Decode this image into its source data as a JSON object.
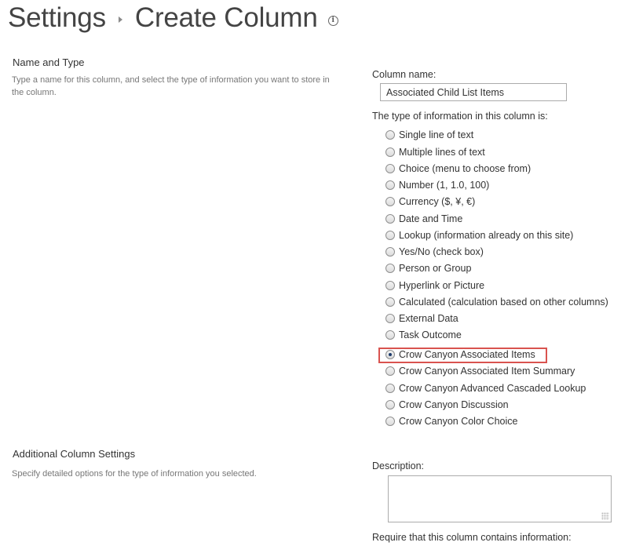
{
  "header": {
    "breadcrumb_root": "Settings",
    "page_title": "Create Column",
    "info_icon_glyph": "i"
  },
  "sections": {
    "name_and_type": {
      "title": "Name and Type",
      "description": "Type a name for this column, and select the type of information you want to store in the column."
    },
    "additional": {
      "title": "Additional Column Settings",
      "description": "Specify detailed options for the type of information you selected."
    }
  },
  "form": {
    "column_name_label": "Column name:",
    "column_name_value": "Associated Child List Items",
    "type_label": "The type of information in this column is:",
    "types": [
      {
        "label": "Single line of text",
        "checked": false
      },
      {
        "label": "Multiple lines of text",
        "checked": false
      },
      {
        "label": "Choice (menu to choose from)",
        "checked": false
      },
      {
        "label": "Number (1, 1.0, 100)",
        "checked": false
      },
      {
        "label": "Currency ($, ¥, €)",
        "checked": false
      },
      {
        "label": "Date and Time",
        "checked": false
      },
      {
        "label": "Lookup (information already on this site)",
        "checked": false
      },
      {
        "label": "Yes/No (check box)",
        "checked": false
      },
      {
        "label": "Person or Group",
        "checked": false
      },
      {
        "label": "Hyperlink or Picture",
        "checked": false
      },
      {
        "label": "Calculated (calculation based on other columns)",
        "checked": false
      },
      {
        "label": "External Data",
        "checked": false
      },
      {
        "label": "Task Outcome",
        "checked": false
      },
      {
        "label": "Crow Canyon Associated Items",
        "checked": true
      },
      {
        "label": "Crow Canyon Associated Item Summary",
        "checked": false
      },
      {
        "label": "Crow Canyon Advanced Cascaded Lookup",
        "checked": false
      },
      {
        "label": "Crow Canyon Discussion",
        "checked": false
      },
      {
        "label": "Crow Canyon Color Choice",
        "checked": false
      }
    ],
    "description_label": "Description:",
    "description_value": "",
    "require_label": "Require that this column contains information:"
  },
  "colors": {
    "highlight": "#d9534f",
    "text": "#333333",
    "muted": "#777777"
  }
}
